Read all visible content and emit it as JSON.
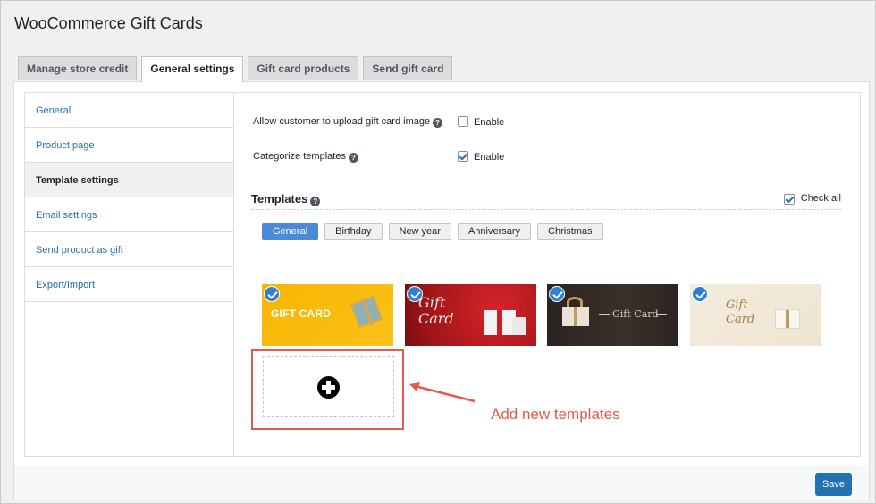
{
  "app": {
    "title": "WooCommerce Gift Cards"
  },
  "tabs": [
    {
      "label": "Manage store credit"
    },
    {
      "label": "General settings"
    },
    {
      "label": "Gift card products"
    },
    {
      "label": "Send gift card"
    }
  ],
  "sidebar": {
    "items": [
      {
        "label": "General"
      },
      {
        "label": "Product page"
      },
      {
        "label": "Template settings"
      },
      {
        "label": "Email settings"
      },
      {
        "label": "Send product as gift"
      },
      {
        "label": "Export/Import"
      }
    ]
  },
  "settings": {
    "upload_image": {
      "label": "Allow customer to upload gift card image",
      "option": "Enable",
      "checked": false
    },
    "categorize": {
      "label": "Categorize templates",
      "option": "Enable",
      "checked": true
    }
  },
  "templates": {
    "title": "Templates",
    "check_all": "Check all",
    "categories": [
      "General",
      "Birthday",
      "New year",
      "Anniversary",
      "Christmas"
    ],
    "active_category": "General",
    "cards": [
      {
        "text": "GIFT CARD",
        "selected": true
      },
      {
        "text_line1": "Gift",
        "text_line2": "Card",
        "selected": true
      },
      {
        "text": "Gift Card",
        "selected": true
      },
      {
        "text_line1": "Gift",
        "text_line2": "Card",
        "selected": true
      }
    ]
  },
  "annotation": {
    "text": "Add new templates",
    "color": "#e45a4a"
  },
  "footer": {
    "save_label": "Save"
  },
  "colors": {
    "accent": "#2271b1",
    "active_category": "#4a8ad6",
    "annotation": "#e45a4a"
  }
}
